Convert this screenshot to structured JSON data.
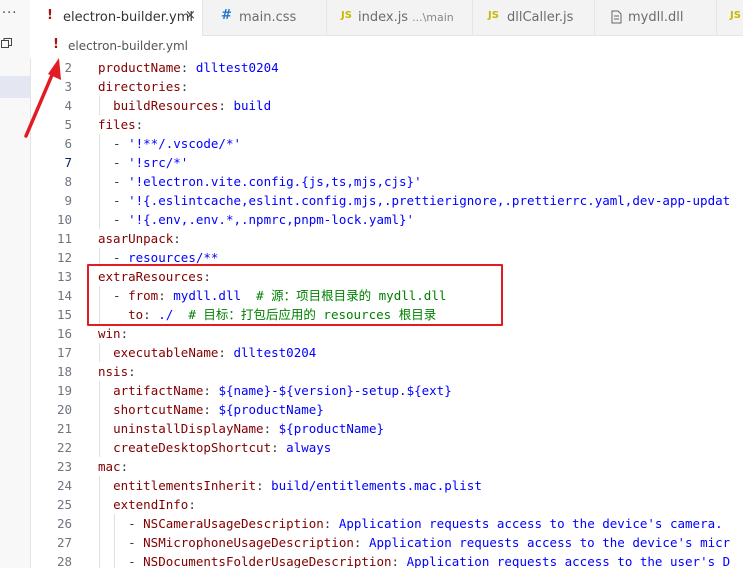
{
  "activity": {
    "more_label": "···"
  },
  "tabs": [
    {
      "icon": "!",
      "icon_color": "#a31515",
      "label": "electron-builder.yml",
      "desc": "",
      "active": true,
      "close": "×"
    },
    {
      "icon": "#",
      "icon_color": "#2277cc",
      "label": "main.css",
      "desc": "",
      "active": false
    },
    {
      "icon": "JS",
      "icon_color": "#c8b900",
      "label": "index.js",
      "desc": "...\\main",
      "active": false
    },
    {
      "icon": "JS",
      "icon_color": "#c8b900",
      "label": "dllCaller.js",
      "desc": "",
      "active": false
    },
    {
      "icon": "file-icon",
      "icon_color": "#666666",
      "label": "mydll.dll",
      "desc": "",
      "active": false
    },
    {
      "icon": "JS",
      "icon_color": "#c8b900",
      "label": "",
      "desc": "",
      "active": false
    }
  ],
  "breadcrumb": {
    "icon": "!",
    "label": "electron-builder.yml"
  },
  "lines": [
    {
      "n": "2",
      "t": [
        [
          "k",
          "productName"
        ],
        [
          "p",
          ": "
        ],
        [
          "v",
          "dlltest0204"
        ]
      ]
    },
    {
      "n": "3",
      "t": [
        [
          "k",
          "directories"
        ],
        [
          "p",
          ":"
        ]
      ]
    },
    {
      "n": "4",
      "t": [
        [
          "p",
          "  "
        ],
        [
          "k",
          "buildResources"
        ],
        [
          "p",
          ": "
        ],
        [
          "v",
          "build"
        ]
      ]
    },
    {
      "n": "5",
      "t": [
        [
          "k",
          "files"
        ],
        [
          "p",
          ":"
        ]
      ]
    },
    {
      "n": "6",
      "t": [
        [
          "p",
          "  - "
        ],
        [
          "s",
          "'!**/.vscode/*'"
        ]
      ]
    },
    {
      "n": "7",
      "t": [
        [
          "p",
          "  - "
        ],
        [
          "s",
          "'!src/*'"
        ]
      ]
    },
    {
      "n": "8",
      "t": [
        [
          "p",
          "  - "
        ],
        [
          "s",
          "'!electron.vite.config.{js,ts,mjs,cjs}'"
        ]
      ]
    },
    {
      "n": "9",
      "t": [
        [
          "p",
          "  - "
        ],
        [
          "s",
          "'!{.eslintcache,eslint.config.mjs,.prettierignore,.prettierrc.yaml,dev-app-updat"
        ]
      ]
    },
    {
      "n": "10",
      "t": [
        [
          "p",
          "  - "
        ],
        [
          "s",
          "'!{.env,.env.*,.npmrc,pnpm-lock.yaml}'"
        ]
      ]
    },
    {
      "n": "11",
      "t": [
        [
          "k",
          "asarUnpack"
        ],
        [
          "p",
          ":"
        ]
      ]
    },
    {
      "n": "12",
      "t": [
        [
          "p",
          "  - "
        ],
        [
          "v",
          "resources/**"
        ]
      ]
    },
    {
      "n": "13",
      "t": [
        [
          "k",
          "extraResources"
        ],
        [
          "p",
          ":"
        ]
      ]
    },
    {
      "n": "14",
      "t": [
        [
          "p",
          "  - "
        ],
        [
          "k",
          "from"
        ],
        [
          "p",
          ": "
        ],
        [
          "v",
          "mydll.dll"
        ],
        [
          "p",
          "  "
        ],
        [
          "c",
          "# 源：项目根目录的 mydll.dll"
        ]
      ]
    },
    {
      "n": "15",
      "t": [
        [
          "p",
          "    "
        ],
        [
          "k",
          "to"
        ],
        [
          "p",
          ": "
        ],
        [
          "v",
          "./"
        ],
        [
          "p",
          "  "
        ],
        [
          "c",
          "# 目标：打包后应用的 resources 根目录"
        ]
      ]
    },
    {
      "n": "16",
      "t": [
        [
          "k",
          "win"
        ],
        [
          "p",
          ":"
        ]
      ]
    },
    {
      "n": "17",
      "t": [
        [
          "p",
          "  "
        ],
        [
          "k",
          "executableName"
        ],
        [
          "p",
          ": "
        ],
        [
          "v",
          "dlltest0204"
        ]
      ]
    },
    {
      "n": "18",
      "t": [
        [
          "k",
          "nsis"
        ],
        [
          "p",
          ":"
        ]
      ]
    },
    {
      "n": "19",
      "t": [
        [
          "p",
          "  "
        ],
        [
          "k",
          "artifactName"
        ],
        [
          "p",
          ": "
        ],
        [
          "v",
          "${name}-${version}-setup.${ext}"
        ]
      ]
    },
    {
      "n": "20",
      "t": [
        [
          "p",
          "  "
        ],
        [
          "k",
          "shortcutName"
        ],
        [
          "p",
          ": "
        ],
        [
          "v",
          "${productName}"
        ]
      ]
    },
    {
      "n": "21",
      "t": [
        [
          "p",
          "  "
        ],
        [
          "k",
          "uninstallDisplayName"
        ],
        [
          "p",
          ": "
        ],
        [
          "v",
          "${productName}"
        ]
      ]
    },
    {
      "n": "22",
      "t": [
        [
          "p",
          "  "
        ],
        [
          "k",
          "createDesktopShortcut"
        ],
        [
          "p",
          ": "
        ],
        [
          "v",
          "always"
        ]
      ]
    },
    {
      "n": "23",
      "t": [
        [
          "k",
          "mac"
        ],
        [
          "p",
          ":"
        ]
      ]
    },
    {
      "n": "24",
      "t": [
        [
          "p",
          "  "
        ],
        [
          "k",
          "entitlementsInherit"
        ],
        [
          "p",
          ": "
        ],
        [
          "v",
          "build/entitlements.mac.plist"
        ]
      ]
    },
    {
      "n": "25",
      "t": [
        [
          "p",
          "  "
        ],
        [
          "k",
          "extendInfo"
        ],
        [
          "p",
          ":"
        ]
      ]
    },
    {
      "n": "26",
      "t": [
        [
          "p",
          "    - "
        ],
        [
          "k",
          "NSCameraUsageDescription"
        ],
        [
          "p",
          ": "
        ],
        [
          "v",
          "Application requests access to the device's camera."
        ]
      ]
    },
    {
      "n": "27",
      "t": [
        [
          "p",
          "    - "
        ],
        [
          "k",
          "NSMicrophoneUsageDescription"
        ],
        [
          "p",
          ": "
        ],
        [
          "v",
          "Application requests access to the device's micr"
        ]
      ]
    },
    {
      "n": "28",
      "t": [
        [
          "p",
          "    - "
        ],
        [
          "k",
          "NSDocumentsFolderUsageDescription"
        ],
        [
          "p",
          ": "
        ],
        [
          "v",
          "Application requests access to the user's D"
        ]
      ]
    }
  ],
  "current_line": "7",
  "colors": {
    "key": "#800000",
    "value": "#0000ff",
    "comment": "#008000",
    "highlight_box": "#e31b23",
    "arrow": "#e31b23"
  }
}
